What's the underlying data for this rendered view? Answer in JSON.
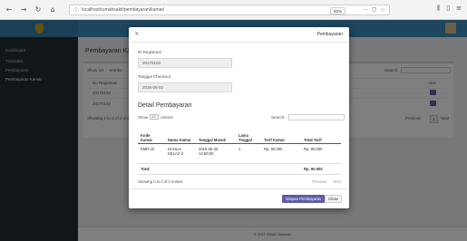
{
  "browser": {
    "url": "localhost/rumahsakit/pembayaran/kamar/",
    "zoom": "90%",
    "overflow_icon": "···",
    "bookmark_icon": "☆",
    "shield_icon": "⛉"
  },
  "app": {
    "sidebar_items": [
      "Dashboard",
      "Transaksi",
      "Pembayaran",
      "Pembayaran Kamar"
    ],
    "page_title": "Pembayaran Kamar",
    "bg_show_label": "Show",
    "bg_show_value": "10",
    "bg_entries_label": "entries",
    "bg_search_label": "Search:",
    "bg_col_no_registrasi": "No Registrasi",
    "bg_col_aksi": "Aksi",
    "bg_rows": [
      "20170103",
      "20170104"
    ],
    "bg_info": "Showing 1 to 2 of 2 entries",
    "bg_previous": "Previous",
    "bg_page": "1",
    "bg_next": "Next",
    "footer": "© 2017 RSUD Sidoarjo"
  },
  "modal": {
    "close": "×",
    "title": "Pembayaran",
    "no_registrasi_label": "ID Registrasi",
    "no_registrasi_value": "20170103",
    "tanggal_checkout_label": "Tanggal Checkout",
    "tanggal_checkout_value": "2016-05-02",
    "section_title": "Detail Pembayaran",
    "show_label": "Show",
    "show_value": "10",
    "entries_label": "entries",
    "search_label": "Search:",
    "table": {
      "headers": [
        "Kode Kamar",
        "Nama Kamar",
        "Tanggal Masuk",
        "Lama Tinggal",
        "Tarif Kamar",
        "Total Tarif"
      ],
      "rows": [
        [
          "KMR-10",
          "DAHLIA KELAS 3",
          "2016-05-26 14:50:00",
          "1",
          "Rp. 90.000",
          "Rp. 90.000"
        ]
      ],
      "total_label": "Total",
      "total_value": "Rp. 90.000"
    },
    "info": "Showing 0 to 0 of 0 entries",
    "previous": "Previous",
    "next": "Next",
    "primary_button": "Simpan Pembayaran",
    "close_button": "Close"
  },
  "colors": {
    "header": "#3c8dbc",
    "sidebar": "#222d32",
    "accent": "#605ca8"
  }
}
